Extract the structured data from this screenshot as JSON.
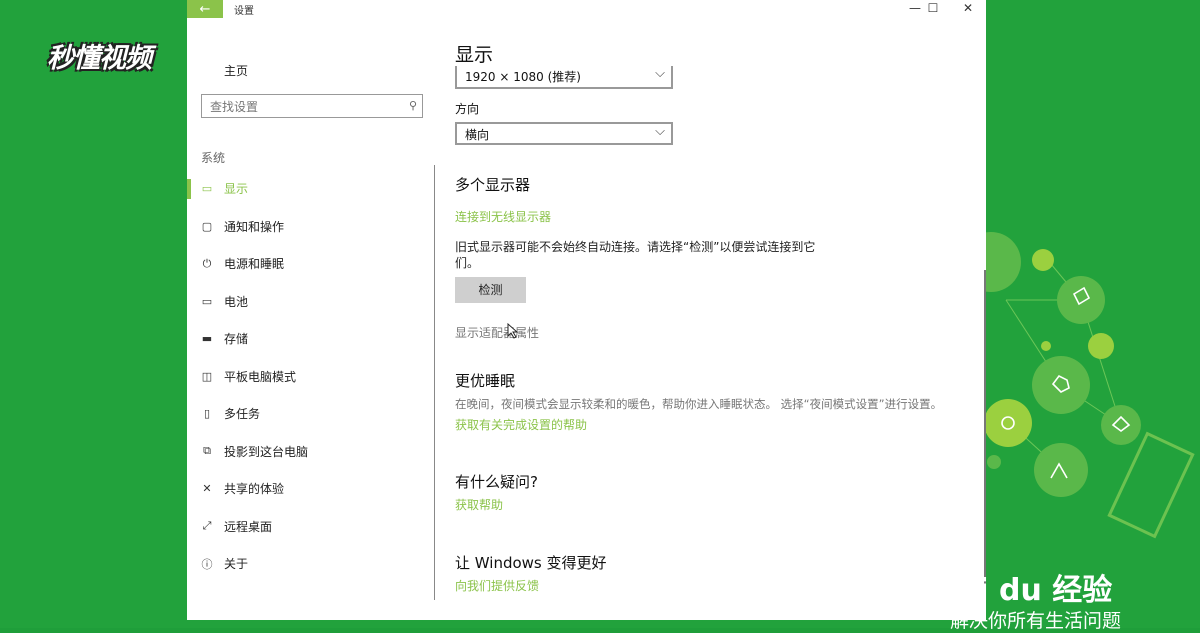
{
  "window": {
    "title": "设置",
    "back_icon": "back-arrow-icon"
  },
  "controls": {
    "minimize": "—",
    "maximize": "☐",
    "close": "✕"
  },
  "sidebar": {
    "home": "主页",
    "search_placeholder": "查找设置",
    "section": "系统",
    "items": [
      {
        "label": "显示",
        "icon": "monitor-icon",
        "active": true
      },
      {
        "label": "通知和操作",
        "icon": "message-icon",
        "active": false
      },
      {
        "label": "电源和睡眠",
        "icon": "power-icon",
        "active": false
      },
      {
        "label": "电池",
        "icon": "battery-icon",
        "active": false
      },
      {
        "label": "存储",
        "icon": "storage-icon",
        "active": false
      },
      {
        "label": "平板电脑模式",
        "icon": "tablet-icon",
        "active": false
      },
      {
        "label": "多任务",
        "icon": "multitask-icon",
        "active": false
      },
      {
        "label": "投影到这台电脑",
        "icon": "project-icon",
        "active": false
      },
      {
        "label": "共享的体验",
        "icon": "share-icon",
        "active": false
      },
      {
        "label": "远程桌面",
        "icon": "remote-icon",
        "active": false
      },
      {
        "label": "关于",
        "icon": "info-icon",
        "active": false
      }
    ]
  },
  "main": {
    "title": "显示",
    "resolution": "1920 × 1080 (推荐)",
    "orientation_label": "方向",
    "orientation": "横向",
    "multi_title": "多个显示器",
    "wireless_link": "连接到无线显示器",
    "legacy_text_1": "旧式显示器可能不会始终自动连接。请选择“检测”以便尝试连接到它",
    "legacy_text_2": "们。",
    "detect_button": "检测",
    "adapter_link": "显示适配器属性",
    "sleep_title": "更优睡眠",
    "sleep_text": "在晚间，夜间模式会显示较柔和的暖色，帮助你进入睡眠状态。 选择“夜间模式设置”进行设置。",
    "sleep_help": "获取有关完成设置的帮助",
    "question_title": "有什么疑问?",
    "question_help": "获取帮助",
    "improve_title": "让 Windows 变得更好",
    "improve_link": "向我们提供反馈"
  },
  "watermark": {
    "logo": "秒懂视频",
    "baidu": "ai du 经验",
    "baidu_sub": "解决你所有生活问题"
  },
  "colors": {
    "accent": "#8bc34a",
    "background": "#22a23c"
  }
}
